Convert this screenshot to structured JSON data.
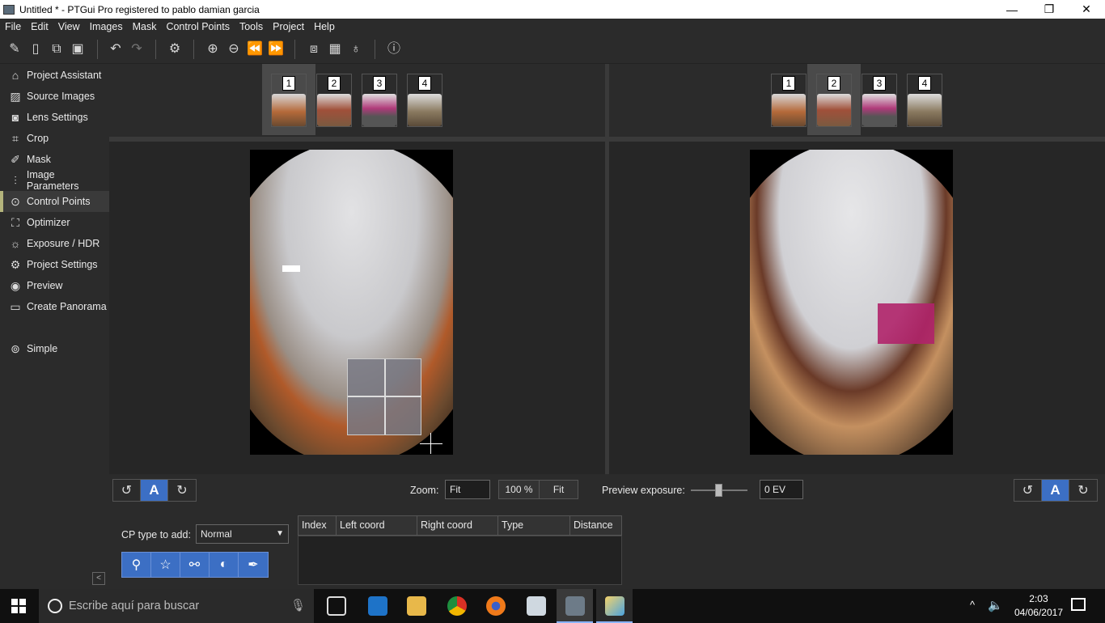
{
  "window": {
    "title": "Untitled * - PTGui Pro registered to pablo damian garcia"
  },
  "menu": [
    "File",
    "Edit",
    "View",
    "Images",
    "Mask",
    "Control Points",
    "Tools",
    "Project",
    "Help"
  ],
  "sidebar": {
    "items": [
      {
        "label": "Project Assistant",
        "icon": "home-icon"
      },
      {
        "label": "Source Images",
        "icon": "image-icon"
      },
      {
        "label": "Lens Settings",
        "icon": "camera-icon"
      },
      {
        "label": "Crop",
        "icon": "crop-icon"
      },
      {
        "label": "Mask",
        "icon": "mask-pen-icon"
      },
      {
        "label": "Image Parameters",
        "icon": "sliders-icon"
      },
      {
        "label": "Control Points",
        "icon": "control-points-icon"
      },
      {
        "label": "Optimizer",
        "icon": "optimizer-icon"
      },
      {
        "label": "Exposure / HDR",
        "icon": "sun-icon"
      },
      {
        "label": "Project Settings",
        "icon": "gear-icon"
      },
      {
        "label": "Preview",
        "icon": "eye-icon"
      },
      {
        "label": "Create Panorama",
        "icon": "panorama-icon"
      }
    ],
    "simple_label": "Simple"
  },
  "left_pane": {
    "thumbs": [
      "1",
      "2",
      "3",
      "4"
    ],
    "selected": "1"
  },
  "right_pane": {
    "thumbs": [
      "1",
      "2",
      "3",
      "4"
    ],
    "selected": "2"
  },
  "bottom": {
    "zoom_label": "Zoom:",
    "zoom_value": "Fit",
    "zoom_100": "100 %",
    "zoom_fit": "Fit",
    "preview_exposure_label": "Preview exposure:",
    "exposure_value": "0 EV",
    "auto_label": "A"
  },
  "cp": {
    "type_label": "CP type to add:",
    "type_value": "Normal",
    "columns": [
      "Index",
      "Left coord",
      "Right coord",
      "Type",
      "Distance"
    ]
  },
  "taskbar": {
    "search_placeholder": "Escribe aquí para buscar",
    "time": "2:03",
    "date": "04/06/2017"
  },
  "colors": {
    "accent": "#3c6fc4",
    "active_marker": "#b4b47c"
  }
}
